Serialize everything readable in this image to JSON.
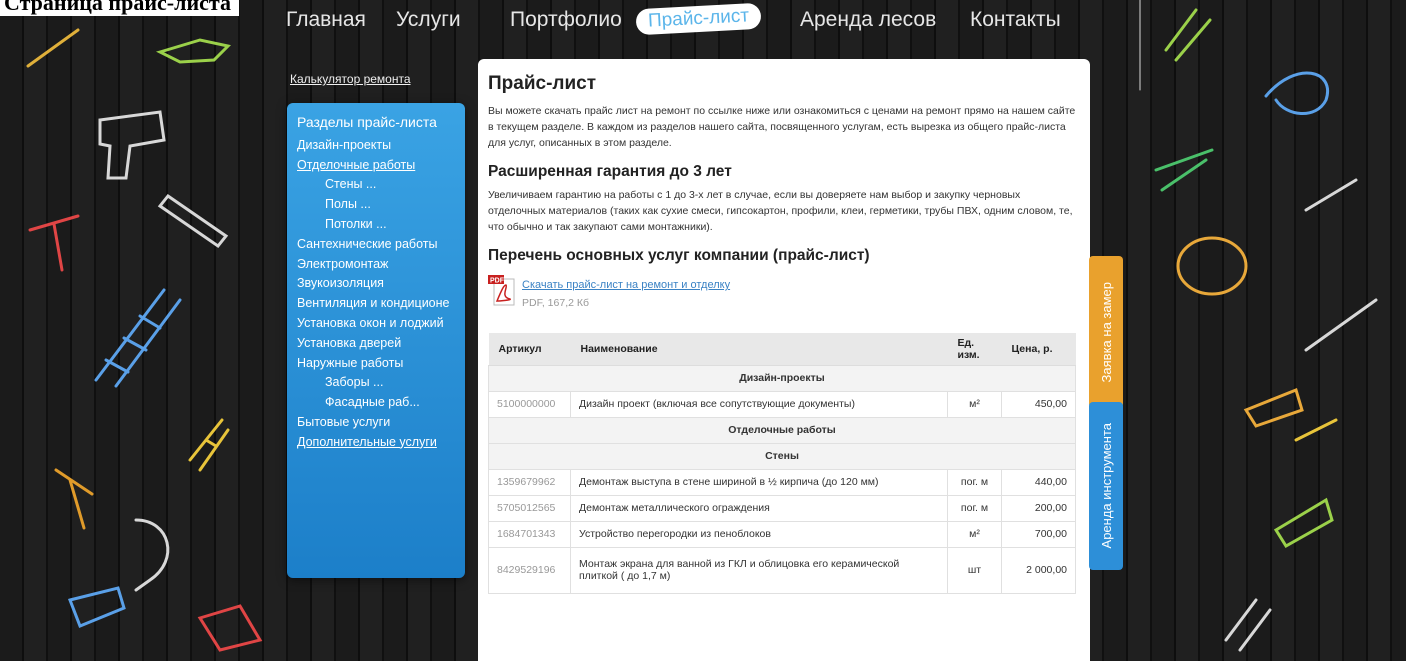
{
  "page_heading": "Страница прайс-листа",
  "nav": [
    {
      "label": "Главная"
    },
    {
      "label": "Услуги"
    },
    {
      "label": "Портфолио"
    },
    {
      "label": "Прайс-лист"
    },
    {
      "label": "Аренда лесов"
    },
    {
      "label": "Контакты"
    }
  ],
  "calc_link": "Калькулятор ремонта",
  "sidebar": {
    "title": "Разделы прайс-листа",
    "items": [
      {
        "label": "Дизайн-проекты"
      },
      {
        "label": "Отделочные работы"
      },
      {
        "label": "Стены ..."
      },
      {
        "label": "Полы ..."
      },
      {
        "label": "Потолки ..."
      },
      {
        "label": "Сантехнические работы"
      },
      {
        "label": "Электромонтаж"
      },
      {
        "label": "Звукоизоляция"
      },
      {
        "label": "Вентиляция и кондиционе"
      },
      {
        "label": "Установка окон и лоджий"
      },
      {
        "label": "Установка дверей"
      },
      {
        "label": "Наружные работы"
      },
      {
        "label": "Заборы ..."
      },
      {
        "label": "Фасадные раб..."
      },
      {
        "label": "Бытовые услуги"
      },
      {
        "label": "Дополнительные услуги"
      }
    ]
  },
  "content": {
    "title": "Прайс-лист",
    "intro": "Вы можете скачать прайс лист на ремонт по ссылке ниже или ознакомиться с ценами на ремонт прямо на нашем сайте в текущем разделе. В каждом из разделов нашего сайта, посвященного услугам, есть вырезка из общего прайс-листа для услуг, описанных в этом разделе.",
    "warranty_title": "Расширенная гарантия до 3 лет",
    "warranty_text": "Увеличиваем гарантию на работы с 1 до 3-х лет в случае, если вы доверяете нам выбор и закупку черновых отделочных материалов (таких как сухие смеси, гипсокартон, профили, клеи, герметики, трубы ПВХ, одним словом, те, что обычно и так закупают сами монтажники).",
    "services_title": "Перечень основных услуг компании (прайс-лист)",
    "pdf_link": "Скачать прайс-лист на ремонт и отделку",
    "pdf_size": "PDF, 167,2 Кб",
    "pdf_badge": "PDF"
  },
  "table": {
    "headers": {
      "art": "Артикул",
      "name": "Наименование",
      "unit": "Ед. изм.",
      "price": "Цена, р."
    },
    "rows": [
      {
        "section": "Дизайн-проекты"
      },
      {
        "art": "5100000000",
        "name": "Дизайн проект (включая все сопутствующие документы)",
        "unit": "м²",
        "price": "450,00"
      },
      {
        "section": "Отделочные работы"
      },
      {
        "section": "Стены"
      },
      {
        "art": "1359679962",
        "name": "Демонтаж выступа в стене шириной в ½ кирпича (до 120 мм)",
        "unit": "пог. м",
        "price": "440,00"
      },
      {
        "art": "5705012565",
        "name": "Демонтаж металлического ограждения",
        "unit": "пог. м",
        "price": "200,00"
      },
      {
        "art": "1684701343",
        "name": "Устройство перегородки из пеноблоков",
        "unit": "м²",
        "price": "700,00"
      },
      {
        "art": "8429529196",
        "name": "Монтаж экрана для ванной из ГКЛ и облицовка его керамической плиткой ( до 1,7 м)",
        "unit": "шт",
        "price": "2 000,00"
      }
    ]
  },
  "side_tabs": {
    "order": "Заявка на замер",
    "rent": "Аренда инструмента"
  },
  "colors": {
    "sidebar": "#2a92d8",
    "tab_order": "#e9a12d",
    "tab_rent": "#2d8fd8",
    "link": "#3a82c4",
    "pdf_red": "#c8201f"
  }
}
